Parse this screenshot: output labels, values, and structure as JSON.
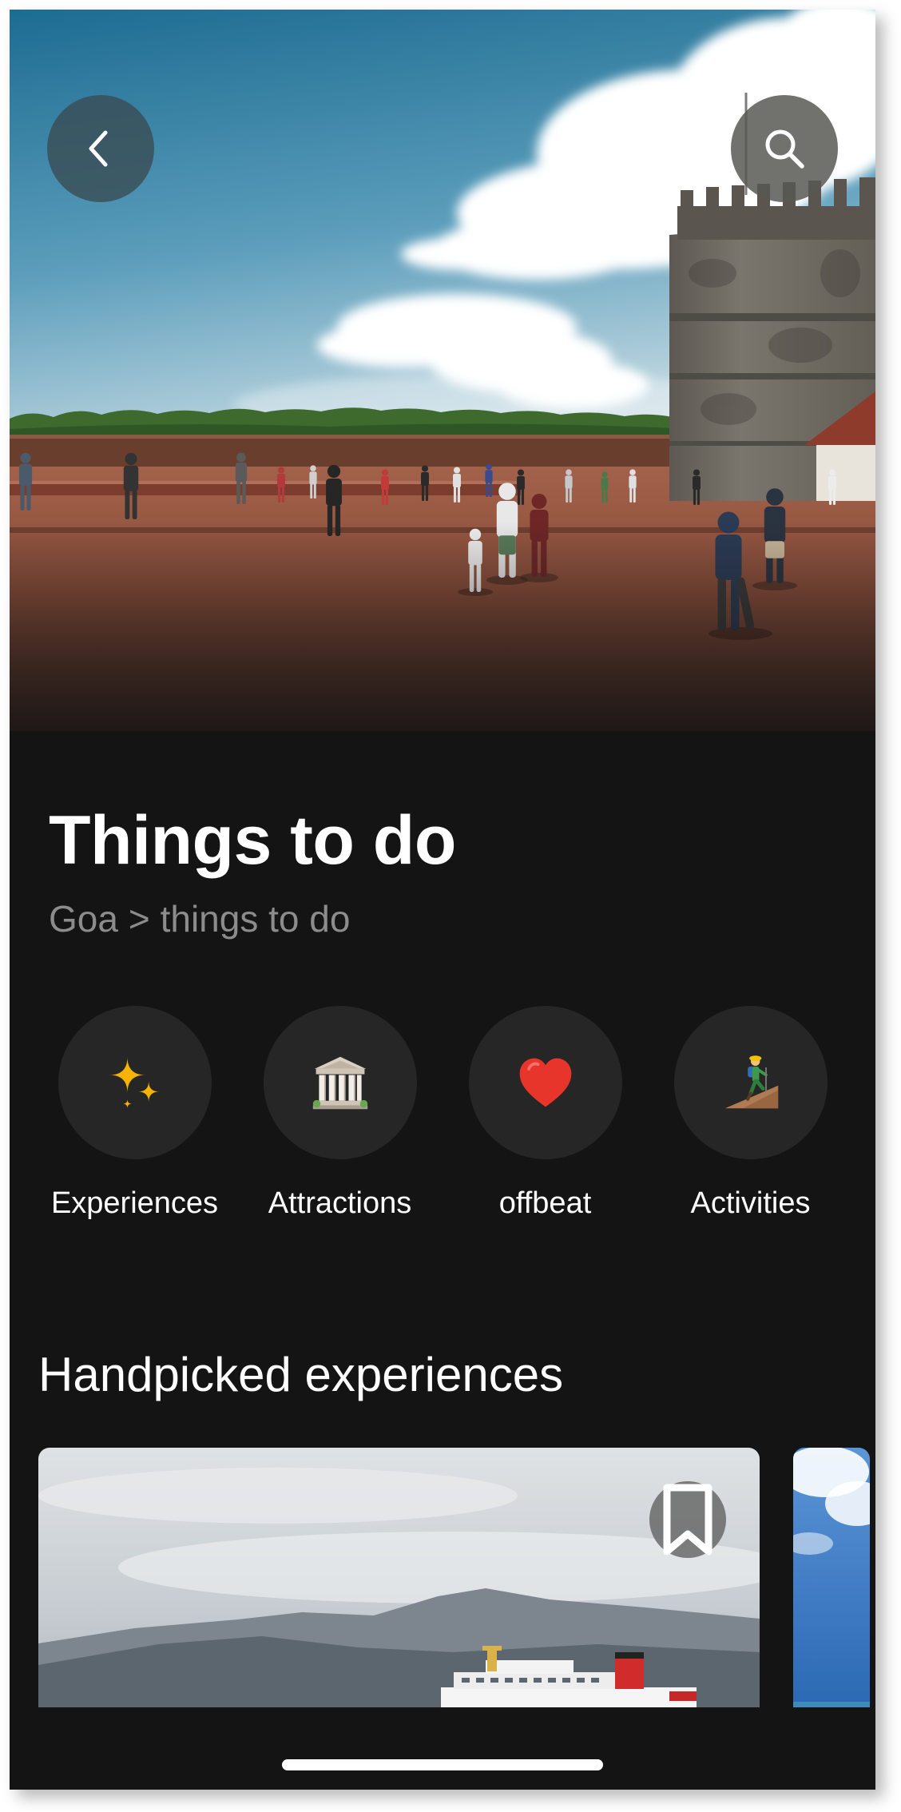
{
  "header": {
    "back_icon": "chevron-left-icon",
    "search_icon": "search-icon"
  },
  "page": {
    "title": "Things to do",
    "breadcrumb": [
      "Goa",
      "things to do"
    ],
    "breadcrumb_separator": ">"
  },
  "categories": [
    {
      "label": "Experiences",
      "icon": "sparkles-icon"
    },
    {
      "label": "Attractions",
      "icon": "classical-building-icon"
    },
    {
      "label": "offbeat",
      "icon": "heart-icon"
    },
    {
      "label": "Activities",
      "icon": "hiker-icon"
    }
  ],
  "sections": {
    "handpicked": {
      "title": "Handpicked experiences",
      "cards": [
        {
          "bookmark_icon": "bookmark-icon",
          "bookmarked": false
        }
      ]
    }
  },
  "colors": {
    "background": "#141414",
    "category_circle": "#262626",
    "text_primary": "#ffffff",
    "text_secondary": "#8c8c8c",
    "home_indicator": "#ffffff"
  }
}
